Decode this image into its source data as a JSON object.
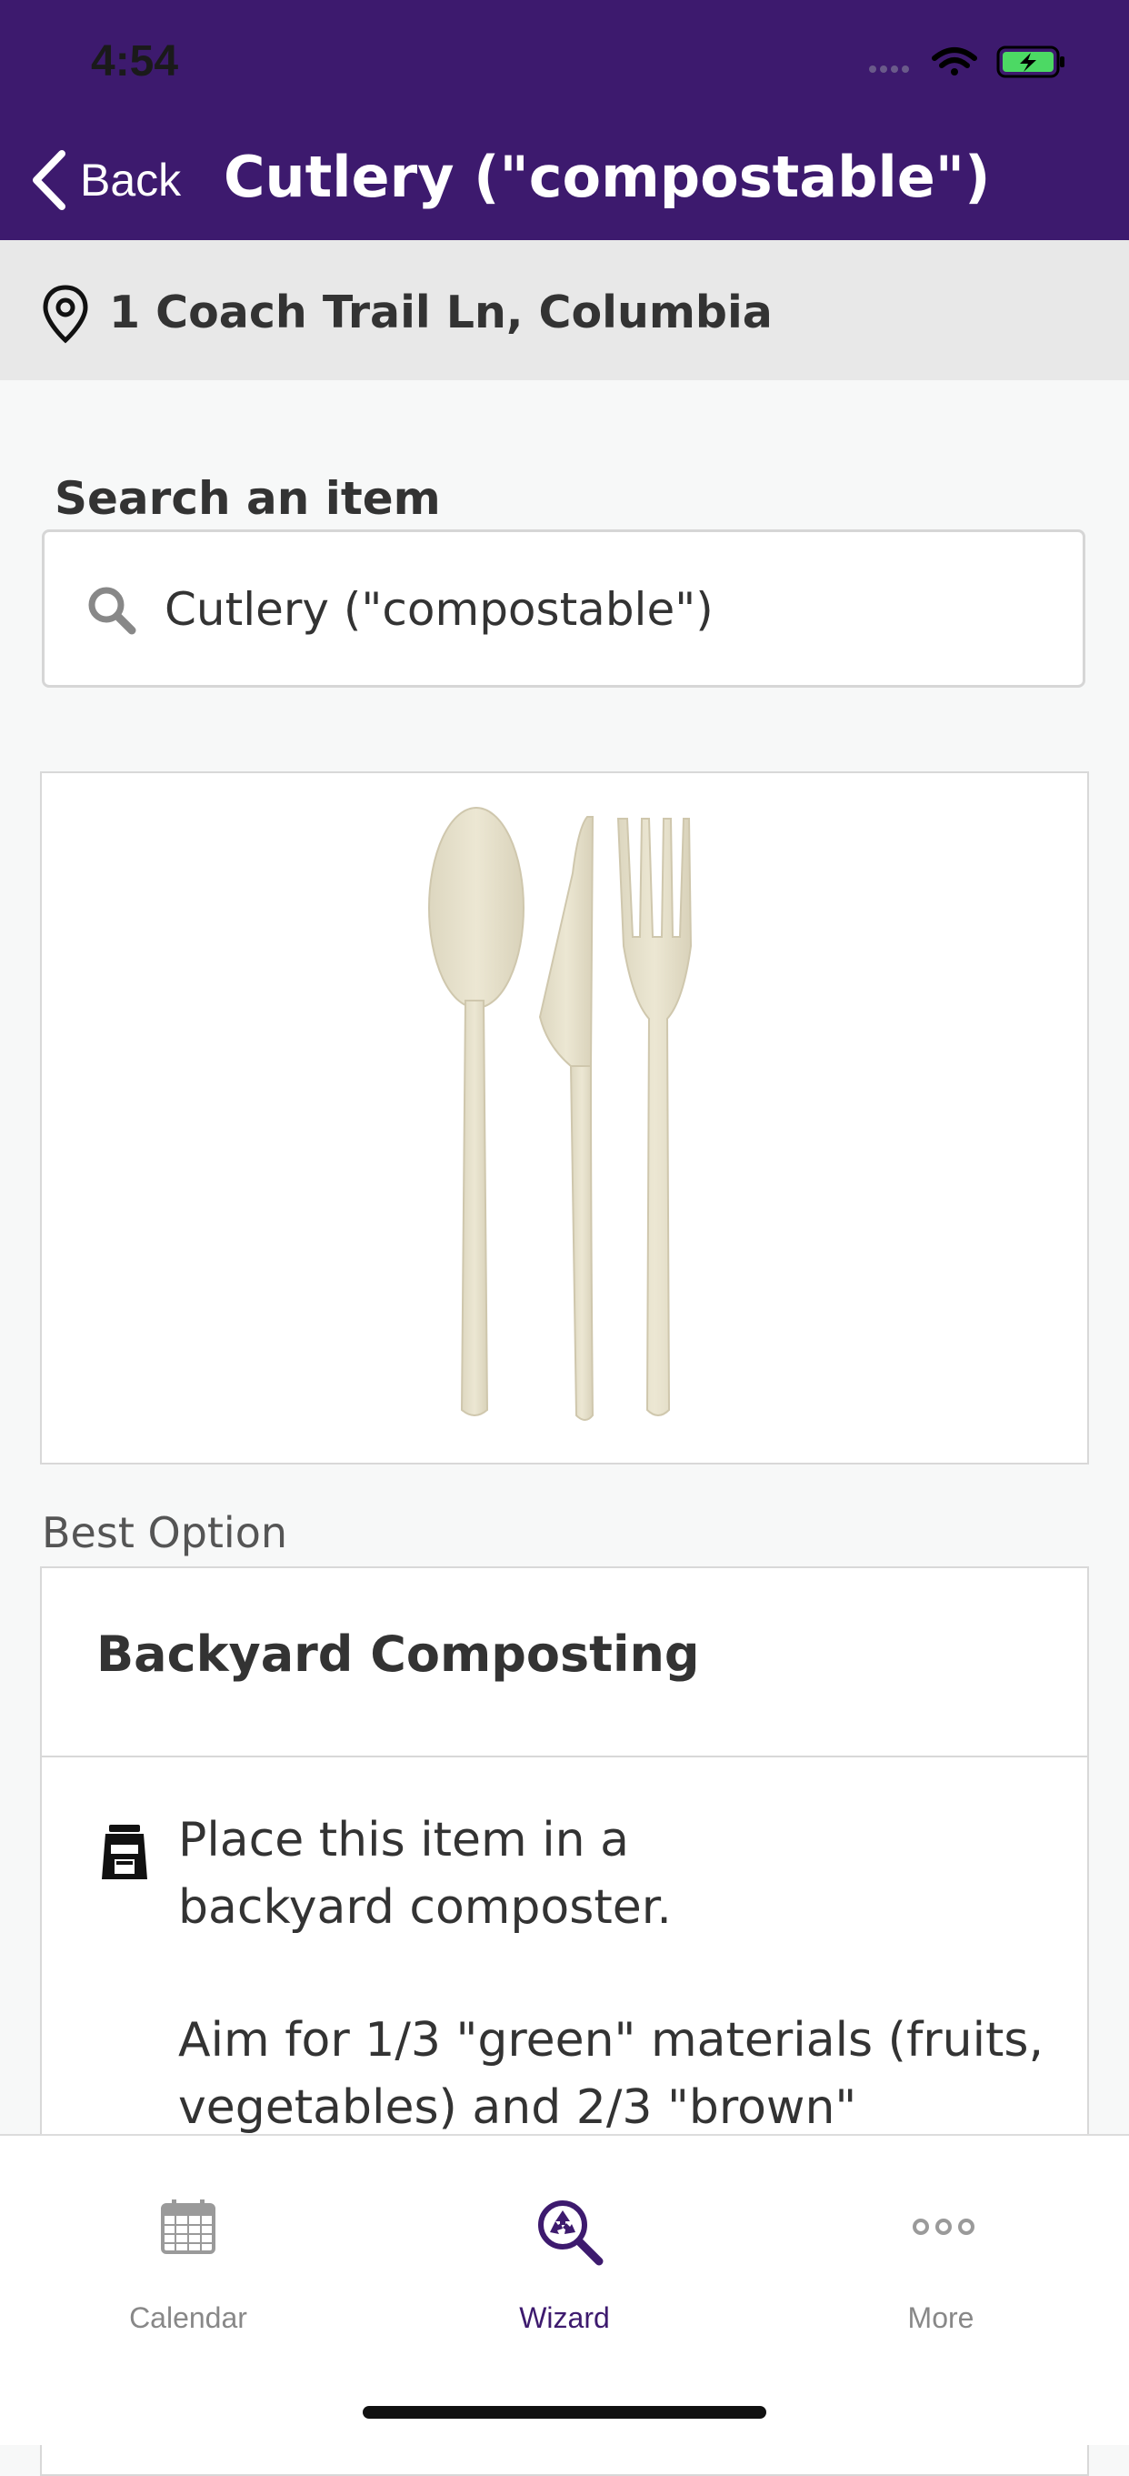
{
  "status_bar": {
    "time": "4:54"
  },
  "header": {
    "back_label": "Back",
    "title": "Cutlery (\"compostable\")",
    "background_color": "#3d1a6e"
  },
  "location": {
    "icon": "map-pin-icon",
    "address": "1 Coach Trail Ln, Columbia"
  },
  "search": {
    "label": "Search an item",
    "icon": "search-icon",
    "value": "Cutlery (\"compostable\")"
  },
  "item_image": {
    "alt": "Compostable spoon, knife and fork"
  },
  "best_option": {
    "section_label": "Best Option",
    "title": "Backyard Composting",
    "icon": "compost-bin-icon",
    "instruction": "Place this item in a backyard composter.",
    "detail": "Aim for 1/3 \"green\" materials (fruits, vegetables) and 2/3 \"brown\""
  },
  "tabbar": {
    "tabs": [
      {
        "label": "Calendar",
        "icon": "calendar-icon",
        "active": false
      },
      {
        "label": "Wizard",
        "icon": "recycle-search-icon",
        "active": true
      },
      {
        "label": "More",
        "icon": "more-dots-icon",
        "active": false
      }
    ],
    "active_color": "#3d1a6e",
    "inactive_color": "#888888"
  }
}
